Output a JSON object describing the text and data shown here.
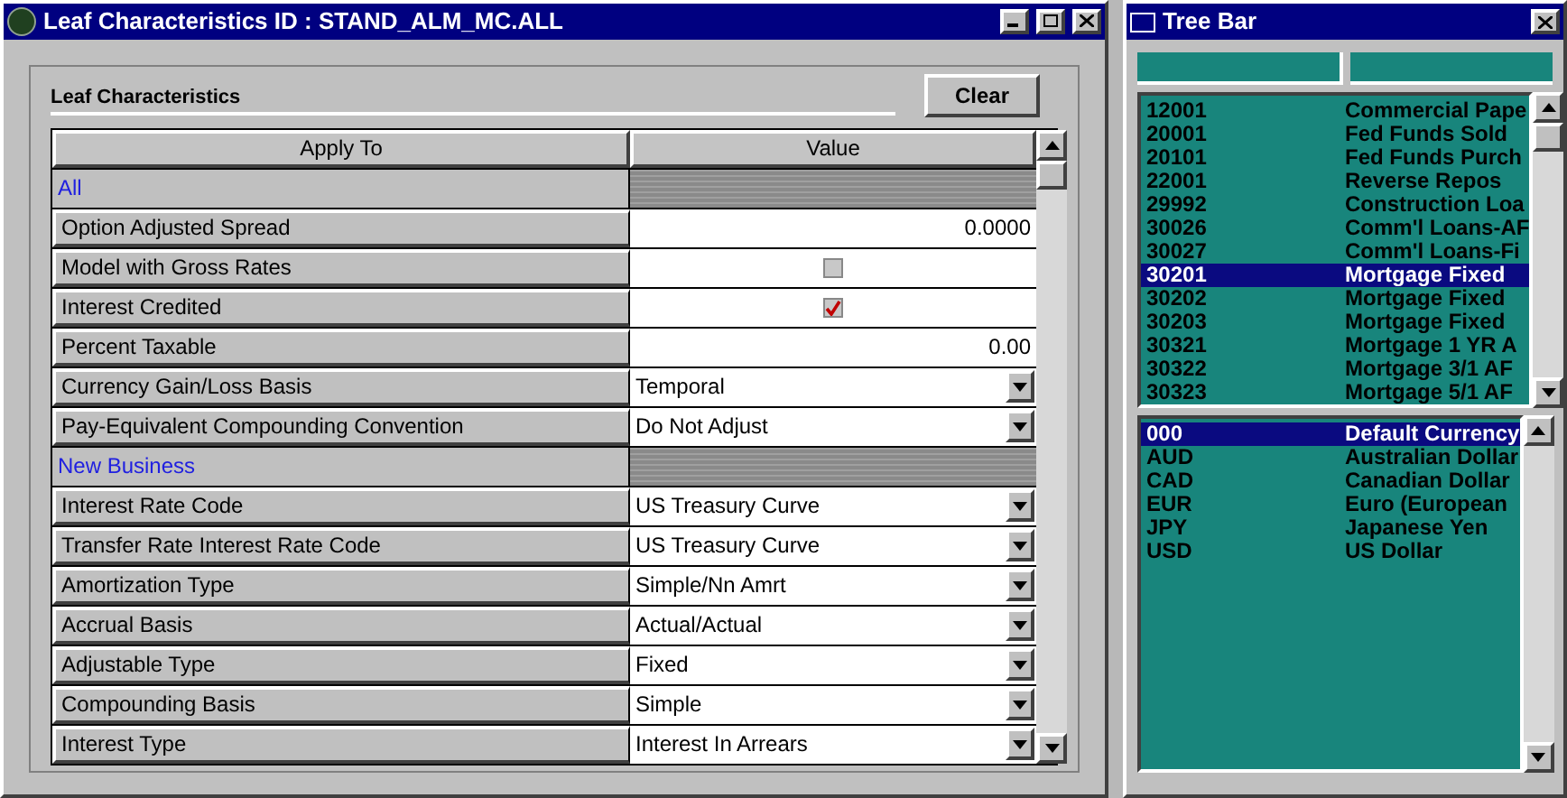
{
  "main_window": {
    "title": "Leaf Characteristics ID : STAND_ALM_MC.ALL"
  },
  "panel": {
    "title": "Leaf Characteristics",
    "clear_button": "Clear"
  },
  "table": {
    "columns": [
      "Apply To",
      "Value"
    ],
    "rows": [
      {
        "kind": "section",
        "label": "All"
      },
      {
        "kind": "number",
        "label": "Option Adjusted Spread",
        "value": "0.0000"
      },
      {
        "kind": "checkbox",
        "label": "Model with Gross Rates",
        "checked": false
      },
      {
        "kind": "checkbox",
        "label": "Interest Credited",
        "checked": true
      },
      {
        "kind": "number",
        "label": "Percent Taxable",
        "value": "0.00"
      },
      {
        "kind": "dropdown",
        "label": "Currency Gain/Loss Basis",
        "value": "Temporal"
      },
      {
        "kind": "dropdown",
        "label": "Pay-Equivalent Compounding Convention",
        "value": "Do Not Adjust"
      },
      {
        "kind": "section",
        "label": "New Business"
      },
      {
        "kind": "dropdown",
        "label": "Interest Rate Code",
        "value": "US Treasury Curve"
      },
      {
        "kind": "dropdown",
        "label": "Transfer Rate Interest Rate Code",
        "value": "US Treasury Curve"
      },
      {
        "kind": "dropdown",
        "label": "Amortization Type",
        "value": "Simple/Nn Amrt"
      },
      {
        "kind": "dropdown",
        "label": "Accrual Basis",
        "value": "Actual/Actual"
      },
      {
        "kind": "dropdown",
        "label": "Adjustable Type",
        "value": "Fixed"
      },
      {
        "kind": "dropdown",
        "label": "Compounding Basis",
        "value": "Simple"
      },
      {
        "kind": "dropdown",
        "label": "Interest Type",
        "value": "Interest In Arrears"
      }
    ]
  },
  "tree_bar": {
    "title": "Tree Bar",
    "leaf_list": [
      {
        "code": "12001",
        "name": "Commercial Pape",
        "selected": false
      },
      {
        "code": "20001",
        "name": "Fed Funds Sold",
        "selected": false
      },
      {
        "code": "20101",
        "name": "Fed Funds Purch",
        "selected": false
      },
      {
        "code": "22001",
        "name": "Reverse Repos",
        "selected": false
      },
      {
        "code": "29992",
        "name": "Construction Loa",
        "selected": false
      },
      {
        "code": "30026",
        "name": "Comm'l Loans-AF",
        "selected": false
      },
      {
        "code": "30027",
        "name": "Comm'l Loans-Fi",
        "selected": false
      },
      {
        "code": "30201",
        "name": "Mortgage Fixed",
        "selected": true
      },
      {
        "code": "30202",
        "name": "Mortgage Fixed",
        "selected": false
      },
      {
        "code": "30203",
        "name": "Mortgage Fixed",
        "selected": false
      },
      {
        "code": "30321",
        "name": "Mortgage 1 YR A",
        "selected": false
      },
      {
        "code": "30322",
        "name": "Mortgage 3/1 AF",
        "selected": false
      },
      {
        "code": "30323",
        "name": "Mortgage 5/1 AF",
        "selected": false
      }
    ],
    "currency_list": [
      {
        "code": "000",
        "name": "Default Currency",
        "selected": true
      },
      {
        "code": "AUD",
        "name": "Australian Dollar",
        "selected": false
      },
      {
        "code": "CAD",
        "name": "Canadian Dollar",
        "selected": false
      },
      {
        "code": "EUR",
        "name": "Euro (European",
        "selected": false
      },
      {
        "code": "JPY",
        "name": "Japanese Yen",
        "selected": false
      },
      {
        "code": "USD",
        "name": "US Dollar",
        "selected": false
      }
    ]
  }
}
